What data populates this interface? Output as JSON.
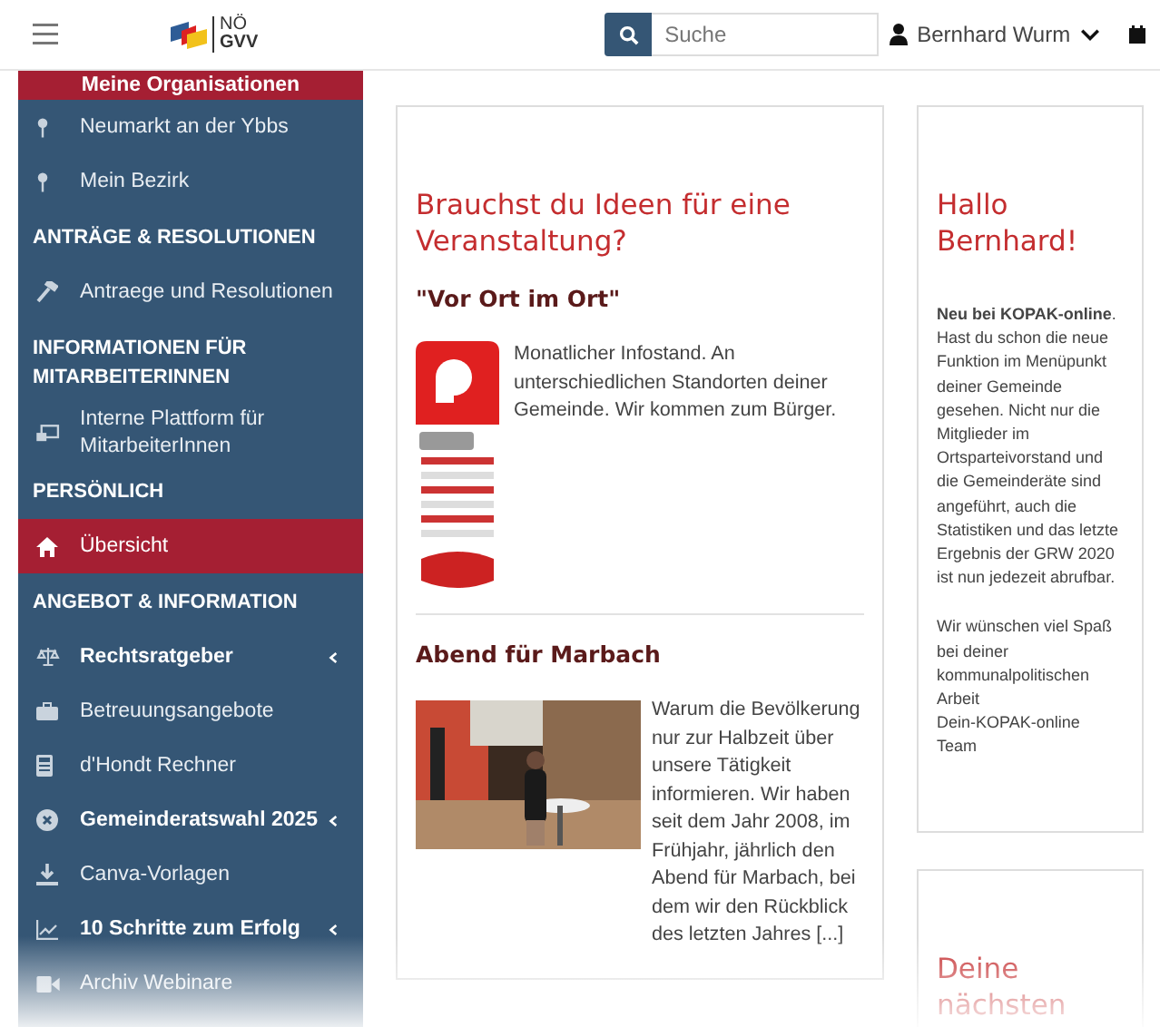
{
  "topbar": {
    "logo": {
      "line_1": "NÖ",
      "line_2": "GVV"
    },
    "search": {
      "placeholder": "Suche"
    },
    "user": "Bernhard Wurm"
  },
  "sidebar": {
    "items": [
      {
        "kind": "org_header",
        "label": "Meine Organisationen"
      },
      {
        "kind": "link",
        "label": "Neumarkt an der Ybbs",
        "selected": false,
        "expandable": false
      },
      {
        "kind": "link",
        "label": "Mein Bezirk",
        "selected": false,
        "expandable": false
      },
      {
        "kind": "section",
        "label": "ANTRÄGE & RESOLUTIONEN"
      },
      {
        "kind": "link",
        "label": "Antraege und Resolutionen",
        "selected": false,
        "expandable": false
      },
      {
        "kind": "section",
        "label": "INFORMATIONEN FÜR MITARBEITERINNEN"
      },
      {
        "kind": "link",
        "label": "Interne Plattform für MitarbeiterInnen",
        "selected": false,
        "expandable": false
      },
      {
        "kind": "section",
        "label": "PERSÖNLICH"
      },
      {
        "kind": "link",
        "label": "Übersicht",
        "selected": true,
        "expandable": false
      },
      {
        "kind": "section",
        "label": "ANGEBOT & INFORMATION"
      },
      {
        "kind": "link",
        "label": "Rechtsratgeber",
        "selected": false,
        "expandable": true
      },
      {
        "kind": "link",
        "label": "Betreuungsangebote",
        "selected": false,
        "expandable": false
      },
      {
        "kind": "link",
        "label": "d'Hondt Rechner",
        "selected": false,
        "expandable": false
      },
      {
        "kind": "link",
        "label": "Gemeinderatswahl 2025",
        "selected": false,
        "expandable": true
      },
      {
        "kind": "link",
        "label": "Canva-Vorlagen",
        "selected": false,
        "expandable": false
      },
      {
        "kind": "link",
        "label": "10 Schritte zum Erfolg",
        "selected": false,
        "expandable": true
      },
      {
        "kind": "link",
        "label": "Archiv Webinare",
        "selected": false,
        "expandable": false
      }
    ]
  },
  "main_card": {
    "title": "Brauchst du Ideen für eine Veranstaltung?",
    "articles": [
      {
        "title": "\"Vor Ort im Ort\"",
        "text": "Monatlicher Infostand. An unterschiedlichen Standorten deiner Gemeinde. Wir kommen zum Bürger."
      },
      {
        "title": "Abend für Marbach",
        "text": "Warum die Bevölkerung nur zur Halbzeit über unsere Tätigkeit informieren. Wir haben seit dem Jahr 2008, im Frühjahr, jährlich den Abend für Marbach, bei dem wir den Rückblick des letzten Jahres [...]"
      }
    ]
  },
  "welcome_card": {
    "title": "Hallo Bernhard!",
    "paragraphs": [
      "**Neu bei KOPAK-online**. Hast du schon die neue Funktion im Menüpunkt deiner Gemeinde gesehen. Nicht nur die Mitglieder im Ortsparteivorstand und die Gemeinderäte sind angeführt, auch die Statistiken und das letzte Ergebnis der GRW 2020 ist nun jedezeit abrufbar.",
      "Wir wünschen viel Spaß bei deiner kommunalpolitischen Arbeit",
      "Dein-KOPAK-online Team"
    ]
  },
  "next_card": {
    "title": "Deine nächsten"
  }
}
